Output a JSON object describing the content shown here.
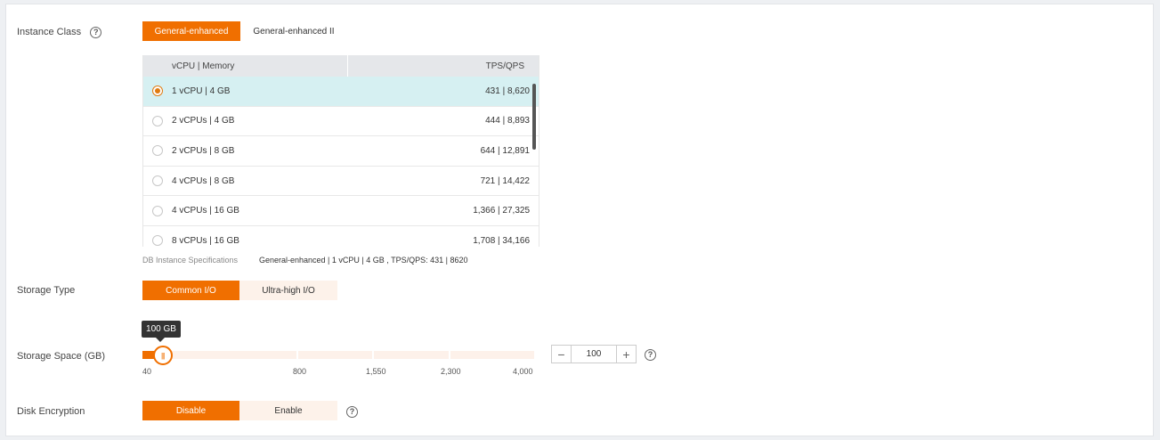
{
  "instance_class": {
    "label": "Instance Class",
    "tabs": [
      {
        "label": "General-enhanced",
        "active": true
      },
      {
        "label": "General-enhanced II",
        "active": false
      }
    ]
  },
  "spec_table": {
    "columns": [
      "vCPU | Memory",
      "TPS/QPS"
    ],
    "rows": [
      {
        "spec": "1 vCPU | 4 GB",
        "perf": "431 | 8,620",
        "selected": true
      },
      {
        "spec": "2 vCPUs | 4 GB",
        "perf": "444 | 8,893",
        "selected": false
      },
      {
        "spec": "2 vCPUs | 8 GB",
        "perf": "644 | 12,891",
        "selected": false
      },
      {
        "spec": "4 vCPUs | 8 GB",
        "perf": "721 | 14,422",
        "selected": false
      },
      {
        "spec": "4 vCPUs | 16 GB",
        "perf": "1,366 | 27,325",
        "selected": false
      },
      {
        "spec": "8 vCPUs | 16 GB",
        "perf": "1,708 | 34,166",
        "selected": false
      }
    ]
  },
  "db_spec": {
    "label": "DB Instance Specifications",
    "value": "General-enhanced | 1 vCPU | 4 GB , TPS/QPS: 431 | 8620"
  },
  "storage_type": {
    "label": "Storage Type",
    "options": [
      {
        "label": "Common I/O",
        "active": true
      },
      {
        "label": "Ultra-high I/O",
        "active": false
      }
    ]
  },
  "storage_space": {
    "label": "Storage Space (GB)",
    "tooltip": "100 GB",
    "value": "100",
    "min": 40,
    "max": 4000,
    "current": 100,
    "ticks": [
      "40",
      "800",
      "1,550",
      "2,300",
      "4,000"
    ]
  },
  "disk_encryption": {
    "label": "Disk Encryption",
    "options": [
      {
        "label": "Disable",
        "active": true
      },
      {
        "label": "Enable",
        "active": false
      }
    ]
  },
  "colors": {
    "accent": "#f06f00",
    "selected_row": "#d6f0f2"
  }
}
